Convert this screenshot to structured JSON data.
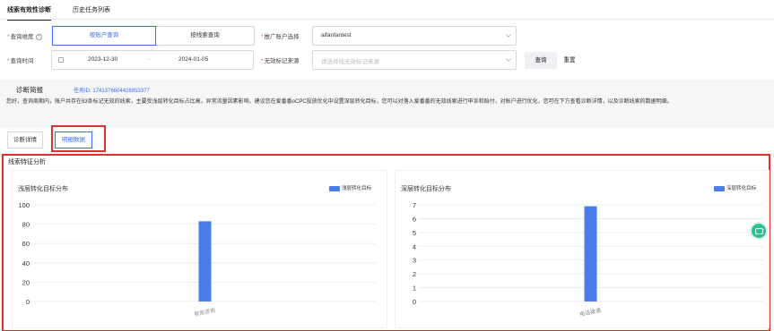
{
  "top_tabs": [
    {
      "label": "线索有效性诊断",
      "active": true
    },
    {
      "label": "历史任务列表",
      "active": false
    }
  ],
  "query_dimension": {
    "label": "查询维度",
    "options": [
      "按账户查询",
      "按线索查询"
    ],
    "selected": "按账户查询"
  },
  "account_select": {
    "label": "推广账户选择",
    "value": "aifanfantest"
  },
  "query_time": {
    "label": "查询时间",
    "start": "2023-12-30",
    "separator": "-",
    "end": "2024-01-05"
  },
  "invalid_source": {
    "label": "无效标记来源",
    "placeholder": "请选择线无效标记来源"
  },
  "buttons": {
    "query": "查询",
    "reset": "重置"
  },
  "diagnosis": {
    "title": "诊断简报",
    "task_id": "任务ID: 1741376604428853377",
    "text": "您好，查询周期内，账户共存在83条标记无效的线索，主要受浅层转化目标占比高，异常流量因素影响，建议您在爱番番oCPC投放优化中设置深层转化目标，您可以对落入爱番番的无效线索进行申诉和赔付，对账户进行优化，您可在下方查看诊断详情，以及诊断线索的数据明细。"
  },
  "sub_tabs": [
    {
      "label": "诊断详情",
      "active": false
    },
    {
      "label": "明细数据",
      "active": true
    }
  ],
  "section_title": "线索特征分析",
  "colors": {
    "accent": "#3a6cf6",
    "bar": "#4a7dea",
    "highlight": "#e03131",
    "float_button": "#2fbf91"
  },
  "float_button_icon": "chat-icon",
  "chart_data": [
    {
      "type": "bar",
      "title": "浅层转化目标分布",
      "series": [
        {
          "name": "浅层转化目标",
          "values": [
            83
          ]
        }
      ],
      "categories": [
        "有效咨询"
      ],
      "yticks": [
        0,
        20,
        40,
        60,
        80,
        100
      ],
      "ylim": [
        0,
        100
      ],
      "legend_position": "top-right",
      "grid": true
    },
    {
      "type": "bar",
      "title": "深层转化目标分布",
      "series": [
        {
          "name": "深层转化目标",
          "values": [
            6.9
          ]
        }
      ],
      "categories": [
        "电话拨通"
      ],
      "yticks": [
        0,
        1,
        2,
        3,
        4,
        5,
        6,
        7
      ],
      "ylim": [
        0,
        7
      ],
      "legend_position": "top-right",
      "grid": true
    }
  ]
}
